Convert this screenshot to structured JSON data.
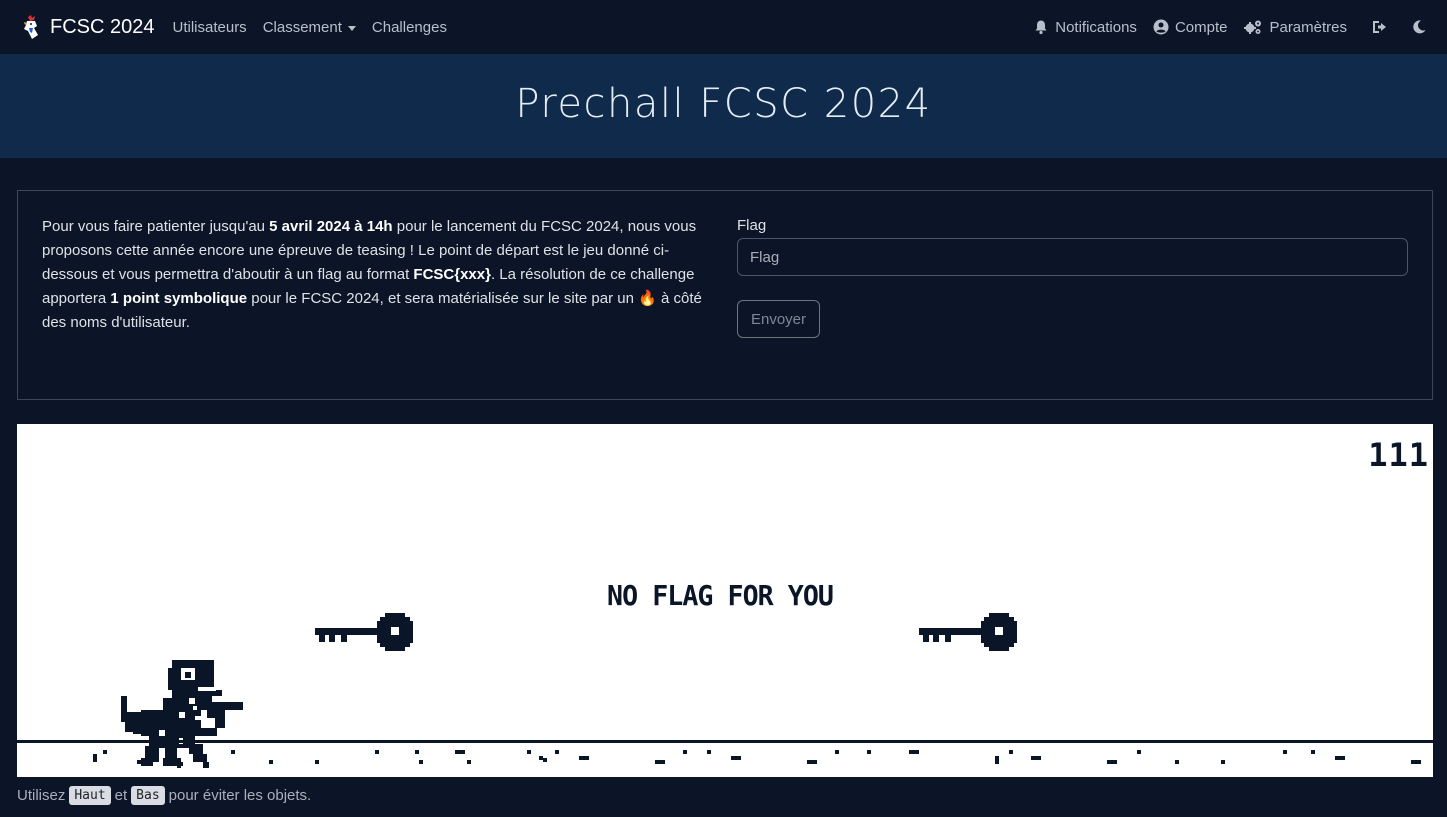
{
  "navbar": {
    "brand": "FCSC 2024",
    "links": [
      {
        "label": "Utilisateurs"
      },
      {
        "label": "Classement"
      },
      {
        "label": "Challenges"
      }
    ],
    "right": [
      {
        "label": "Notifications",
        "icon": "bell-icon"
      },
      {
        "label": "Compte",
        "icon": "user-circle-icon"
      },
      {
        "label": "Paramètres",
        "icon": "gears-icon"
      }
    ],
    "icons": [
      "logout-icon",
      "moon-icon"
    ]
  },
  "jumbotron": {
    "title": "Prechall FCSC 2024"
  },
  "intro": {
    "p1": "Pour vous faire patienter jusqu'au ",
    "b1": "5 avril 2024 à 14h",
    "p2": " pour le lancement du FCSC 2024, nous vous proposons cette année encore une épreuve de teasing ! Le point de départ est le jeu donné ci-dessous et vous permettra d'aboutir à un flag au format ",
    "b2": "FCSC{xxx}",
    "p3": ". La résolution de ce challenge apportera ",
    "b3": "1 point symbolique",
    "p4": " pour le FCSC 2024, et sera matérialisée sur le site par un ",
    "emoji": "🔥",
    "p5": " à côté des noms d'utilisateur."
  },
  "form": {
    "label": "Flag",
    "placeholder": "Flag",
    "submit": "Envoyer"
  },
  "game": {
    "score": "111",
    "message": "NO FLAG FOR YOU"
  },
  "hint": {
    "before": "Utilisez",
    "key_up": "Haut",
    "middle": "et",
    "key_down": "Bas",
    "after": "pour éviter les objets."
  },
  "colors": {
    "background": "#0b1527",
    "header": "#0f2a4b",
    "game_ink": "#0a1628"
  }
}
